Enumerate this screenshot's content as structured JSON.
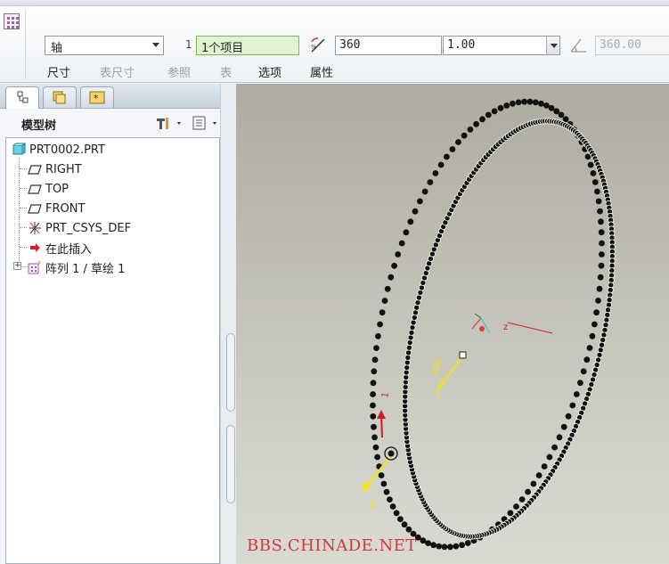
{
  "dashboard": {
    "pattern_type": "轴",
    "reference_index": "1",
    "reference_value": "1个项目",
    "angle_value": "360",
    "scale_value": "1.00",
    "disabled_angle_value": "360.00",
    "tabs": [
      "尺寸",
      "表尺寸",
      "参照",
      "表",
      "选项",
      "属性"
    ]
  },
  "model_tree": {
    "title": "模型树",
    "items": [
      {
        "label": "PRT0002.PRT",
        "icon": "part-icon"
      },
      {
        "label": "RIGHT",
        "icon": "datum-plane-icon"
      },
      {
        "label": "TOP",
        "icon": "datum-plane-icon"
      },
      {
        "label": "FRONT",
        "icon": "datum-plane-icon"
      },
      {
        "label": "PRT_CSYS_DEF",
        "icon": "csys-icon"
      },
      {
        "label": "在此插入",
        "icon": "insert-arrow-icon"
      },
      {
        "label": "阵列 1 / 草绘 1",
        "icon": "pattern-icon"
      }
    ]
  },
  "viewport": {
    "watermark": "BBS.CHINADE.NET",
    "dim_label_1": "1",
    "dim_label_2": "2",
    "dim_label_360": "360",
    "axis_label_x": "z"
  },
  "colors": {
    "dot": "#111111",
    "reference_box_bg": "#dff3cf",
    "watermark": "#d03a3a",
    "dim_yellow": "#f2e21a"
  }
}
